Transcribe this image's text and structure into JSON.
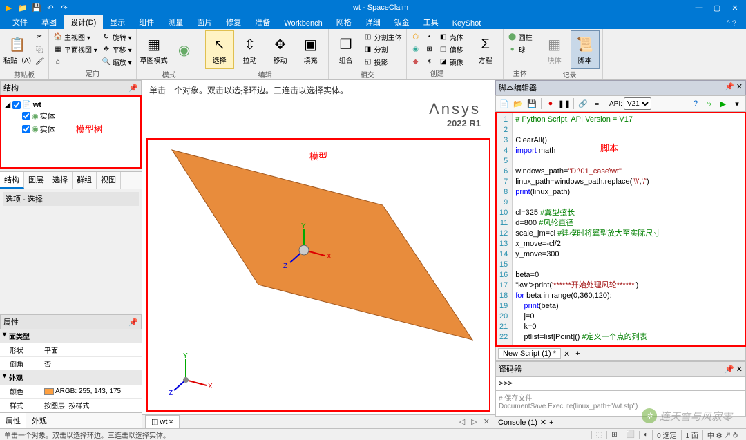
{
  "app": {
    "title": "wt - SpaceClaim"
  },
  "qat": {
    "play_icon": "▶",
    "open_icon": "📁",
    "save_icon": "💾",
    "undo_icon": "↶",
    "redo_icon": "↷"
  },
  "win_controls": {
    "min": "—",
    "max": "▢",
    "close": "✕"
  },
  "ribbon_tabs": {
    "items": [
      "文件",
      "草图",
      "设计(D)",
      "显示",
      "组件",
      "测量",
      "面片",
      "修复",
      "准备",
      "Workbench",
      "网格",
      "详细",
      "钣金",
      "工具",
      "KeyShot"
    ],
    "active_index": 2,
    "help": "^ ?"
  },
  "ribbon_groups": {
    "clipboard": {
      "paste": "粘贴（A)",
      "label": "剪贴板"
    },
    "view": {
      "main_view": "主视图 ▾",
      "plan_view": "平面视图 ▾",
      "spin": "旋转 ▾",
      "flat": "平移 ▾",
      "zoom": "缩放 ▾",
      "home": "⌂",
      "label": "定向"
    },
    "mode": {
      "sketch": "草图模式",
      "body": "",
      "label": "模式"
    },
    "edit": {
      "select": "选择",
      "pull": "拉动",
      "move": "移动",
      "fill": "填充",
      "combine": "组合",
      "split_body": "分割主体",
      "split": "分割",
      "project": "投影",
      "label": "相交"
    },
    "create": {
      "offset": "偏移",
      "shell": "壳体",
      "mirror": "镜像",
      "label": "创建"
    },
    "equation": {
      "eq": "方程",
      "label": ""
    },
    "body": {
      "cyl": "圆柱",
      "sphere": "球",
      "label": "主体"
    },
    "record": {
      "block": "块体",
      "script": "脚本",
      "label": "记录"
    }
  },
  "structure": {
    "header": "结构",
    "root": "wt",
    "children": [
      "实体",
      "实体"
    ],
    "annotation": "模型树",
    "tabs": [
      "结构",
      "图层",
      "选择",
      "群组",
      "视图"
    ],
    "options": "选项 - 选择"
  },
  "properties": {
    "header": "属性",
    "face_type": "面类型",
    "shape_k": "形状",
    "shape_v": "平面",
    "chamfer_k": "倒角",
    "chamfer_v": "否",
    "appearance": "外观",
    "color_k": "颜色",
    "color_v": "ARGB: 255, 143, 175",
    "style_k": "样式",
    "style_v": "按图层, 按样式",
    "bot_tabs": [
      "属性",
      "外观"
    ]
  },
  "viewport": {
    "hint": "单击一个对象。双击以选择环边。三连击以选择实体。",
    "ansys": "Λnsys",
    "ansys_ver": "2022 R1",
    "model_label": "模型",
    "triad": {
      "x": "X",
      "y": "Y",
      "z": "Z"
    },
    "doc_tab": "wt",
    "nav": [
      "◁",
      "▷",
      "✕"
    ]
  },
  "script": {
    "header": "脚本编辑器",
    "api_label": "API:",
    "api_ver": "V21",
    "annotation": "脚本",
    "tab": "New Script (1) *",
    "close": "✕",
    "add": "+",
    "code_lines": [
      {
        "n": 1,
        "raw": "# Python Script, API Version = V17",
        "cls": "cmt"
      },
      {
        "n": 2,
        "raw": ""
      },
      {
        "n": 3,
        "raw": "ClearAll()"
      },
      {
        "n": 4,
        "raw": "import math",
        "kw": "import"
      },
      {
        "n": 5,
        "raw": ""
      },
      {
        "n": 6,
        "raw": "windows_path=\"D:\\01_case\\wt\"",
        "str": true
      },
      {
        "n": 7,
        "raw": "linux_path=windows_path.replace('\\\\','/')",
        "str": true
      },
      {
        "n": 8,
        "raw": "print(linux_path)",
        "kw": "print"
      },
      {
        "n": 9,
        "raw": ""
      },
      {
        "n": 10,
        "raw": "cl=325 #翼型弦长",
        "cmt2": "#翼型弦长"
      },
      {
        "n": 11,
        "raw": "d=800 #风轮直径",
        "cmt2": "#风轮直径"
      },
      {
        "n": 12,
        "raw": "scale_jm=cl #建模时将翼型放大至实际尺寸",
        "cmt2": "#建模时将翼型放大至实际尺寸"
      },
      {
        "n": 13,
        "raw": "x_move=-cl/2"
      },
      {
        "n": 14,
        "raw": "y_move=300"
      },
      {
        "n": 15,
        "raw": ""
      },
      {
        "n": 16,
        "raw": "beta=0"
      },
      {
        "n": 17,
        "raw": "print('******开始处理风轮******')",
        "kw": "print",
        "str": true
      },
      {
        "n": 18,
        "raw": "for beta in range(0,360,120):",
        "kw": "for"
      },
      {
        "n": 19,
        "raw": "    print(beta)",
        "kw": "print"
      },
      {
        "n": 20,
        "raw": "    j=0"
      },
      {
        "n": 21,
        "raw": "    k=0"
      },
      {
        "n": 22,
        "raw": "    ptlist=list[Point]() #定义一个点的列表",
        "cmt2": "#定义一个点的列表"
      }
    ]
  },
  "interp": {
    "header": "译码器",
    "prompt": ">>> ",
    "hist1": "# 保存文件",
    "hist2": "DocumentSave.Execute(linux_path+\"/wt.stp\")",
    "tab": "Console (1)"
  },
  "status": {
    "msg": "单击一个对象。双击以选择环边。三连击以选择实体。",
    "items": [
      "⬚",
      "⊞",
      "⬜",
      "◐",
      "0 选定",
      "1 面",
      "中 ⚙ ↗ ⥁"
    ]
  },
  "watermark": "连天雪与风寂零"
}
